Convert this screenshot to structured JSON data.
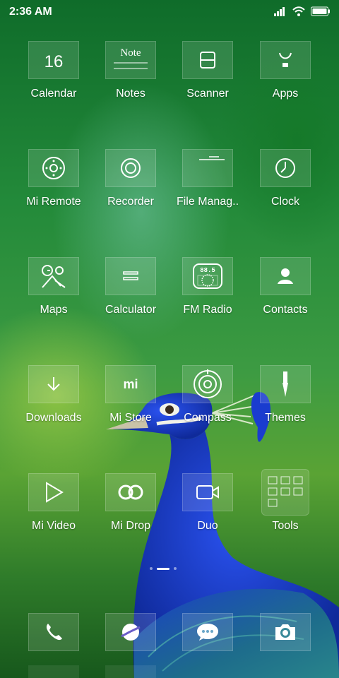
{
  "status": {
    "time": "2:36 AM",
    "icons": [
      "signal-icon",
      "wifi-icon",
      "battery-icon"
    ]
  },
  "apps": [
    {
      "label": "Calendar",
      "icon": "calendar-icon",
      "calendar_day": "16"
    },
    {
      "label": "Notes",
      "icon": "notes-icon",
      "tile_text": "Note"
    },
    {
      "label": "Scanner",
      "icon": "scanner-icon"
    },
    {
      "label": "Apps",
      "icon": "apps-icon"
    },
    {
      "label": "Mi Remote",
      "icon": "remote-icon"
    },
    {
      "label": "Recorder",
      "icon": "recorder-icon"
    },
    {
      "label": "File Manag..",
      "icon": "folder-icon"
    },
    {
      "label": "Clock",
      "icon": "clock-icon"
    },
    {
      "label": "Maps",
      "icon": "maps-icon"
    },
    {
      "label": "Calculator",
      "icon": "calculator-icon"
    },
    {
      "label": "FM Radio",
      "icon": "radio-icon",
      "tile_text": "88.5"
    },
    {
      "label": "Contacts",
      "icon": "contacts-icon"
    },
    {
      "label": "Downloads",
      "icon": "download-icon"
    },
    {
      "label": "Mi Store",
      "icon": "mi-store-icon",
      "tile_text": "mi"
    },
    {
      "label": "Compass",
      "icon": "compass-icon"
    },
    {
      "label": "Themes",
      "icon": "themes-icon"
    },
    {
      "label": "Mi Video",
      "icon": "play-icon"
    },
    {
      "label": "Mi Drop",
      "icon": "mi-drop-icon"
    },
    {
      "label": "Duo",
      "icon": "video-camera-icon"
    },
    {
      "label": "Tools",
      "icon": "tools-folder-icon"
    }
  ],
  "dock": [
    {
      "name": "phone",
      "icon": "phone-icon"
    },
    {
      "name": "browser",
      "icon": "browser-icon"
    },
    {
      "name": "messages",
      "icon": "message-icon"
    },
    {
      "name": "camera",
      "icon": "camera-icon"
    }
  ],
  "pager": {
    "pages": 3,
    "current": 2
  },
  "colors": {
    "tile_bg": "rgba(255,255,255,0.13)",
    "label": "#ffffff",
    "wallpaper_green": "#238a3a",
    "peacock_blue": "#1d3fd0"
  }
}
